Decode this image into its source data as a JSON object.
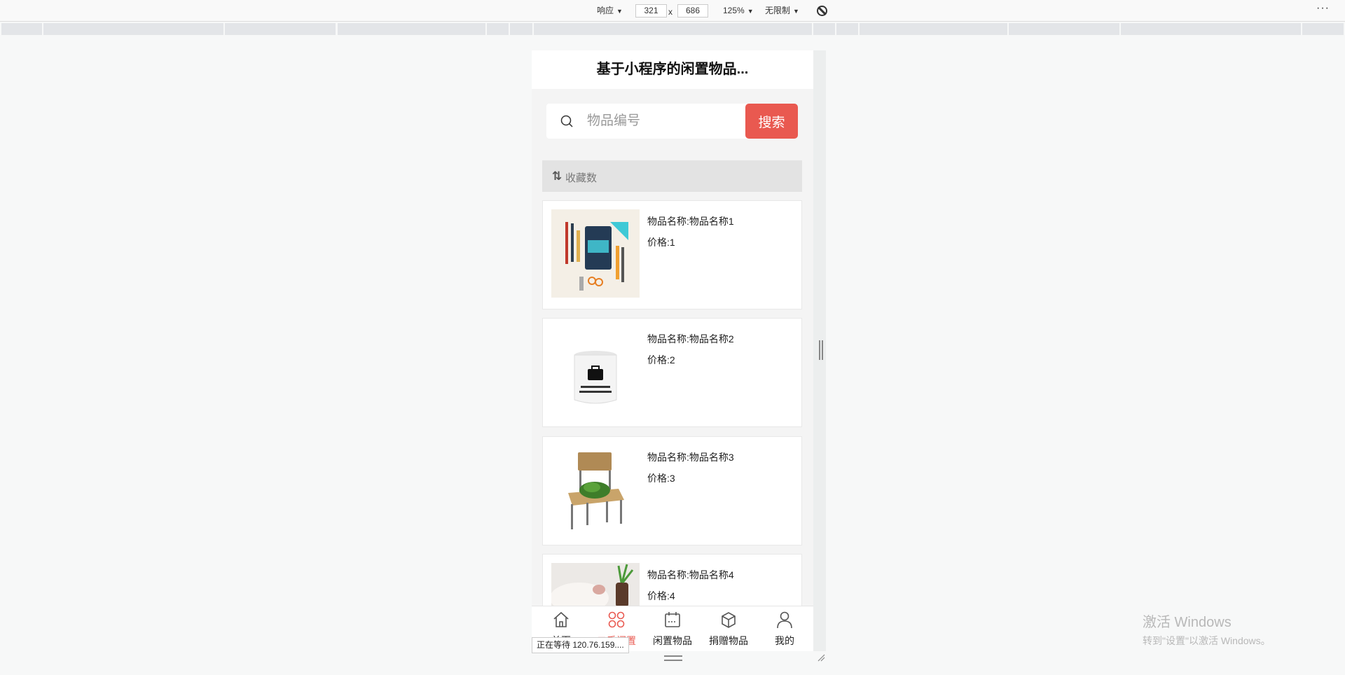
{
  "devtools": {
    "device_mode": "响应",
    "width": "321",
    "times": "x",
    "height": "686",
    "zoom": "125%",
    "throttle": "无限制",
    "more": "···",
    "arrow": "▼"
  },
  "app": {
    "title": "基于小程序的闲置物品...",
    "search": {
      "placeholder": "物品编号",
      "button": "搜索"
    },
    "sort": {
      "icon": "⇅",
      "label": "收藏数"
    },
    "items": [
      {
        "name": "物品名称:物品名称1",
        "price": "价格:1"
      },
      {
        "name": "物品名称:物品名称2",
        "price": "价格:2"
      },
      {
        "name": "物品名称:物品名称3",
        "price": "价格:3"
      },
      {
        "name": "物品名称:物品名称4",
        "price": "价格:4"
      }
    ],
    "tabs": [
      {
        "label": "首页",
        "icon": "home-icon"
      },
      {
        "label": "二手闲置",
        "icon": "grid-icon",
        "active": true
      },
      {
        "label": "闲置物品",
        "icon": "calendar-icon"
      },
      {
        "label": "捐赠物品",
        "icon": "box-icon"
      },
      {
        "label": "我的",
        "icon": "user-icon"
      }
    ],
    "accent": "#e95950"
  },
  "status": "正在等待 120.76.159....",
  "windows": {
    "title": "激活 Windows",
    "subtitle": "转到\"设置\"以激活 Windows。"
  }
}
